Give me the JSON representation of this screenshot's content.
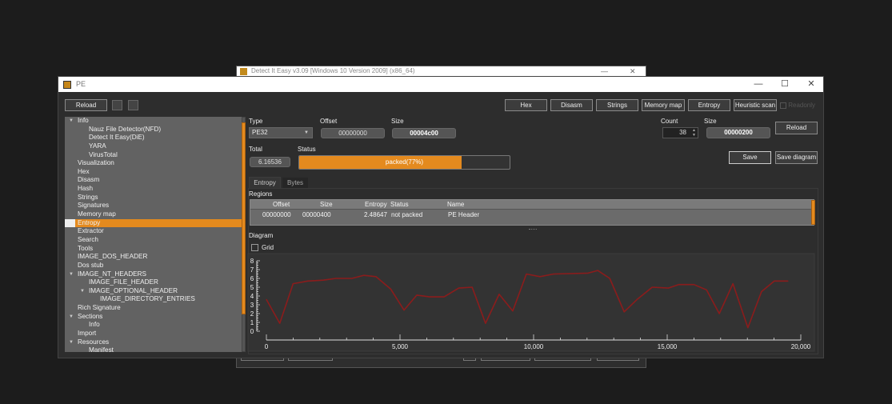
{
  "background_window": {
    "title": "Detect It Easy v3.09 [Windows 10 Version 2009] (x86_64)",
    "controls": {
      "minimize": "—",
      "maximize": "☐",
      "close": "✕"
    }
  },
  "window": {
    "title": "PE",
    "controls": {
      "minimize": "—",
      "maximize": "☐",
      "close": "✕"
    }
  },
  "toolbar": {
    "reload_label": "Reload",
    "buttons": [
      "Hex",
      "Disasm",
      "Strings",
      "Memory map",
      "Entropy",
      "Heuristic scan"
    ],
    "disabled_checkbox_label": "Readonly"
  },
  "sidebar": {
    "items": [
      {
        "label": "Info",
        "level": 0,
        "expanded": true
      },
      {
        "label": "Nauz File Detector(NFD)",
        "level": 1
      },
      {
        "label": "Detect It Easy(DiE)",
        "level": 1
      },
      {
        "label": "YARA",
        "level": 1
      },
      {
        "label": "VirusTotal",
        "level": 1
      },
      {
        "label": "Visualization",
        "level": 0
      },
      {
        "label": "Hex",
        "level": 0
      },
      {
        "label": "Disasm",
        "level": 0
      },
      {
        "label": "Hash",
        "level": 0
      },
      {
        "label": "Strings",
        "level": 0
      },
      {
        "label": "Signatures",
        "level": 0
      },
      {
        "label": "Memory map",
        "level": 0
      },
      {
        "label": "Entropy",
        "level": 0,
        "selected": true
      },
      {
        "label": "Extractor",
        "level": 0
      },
      {
        "label": "Search",
        "level": 0
      },
      {
        "label": "Tools",
        "level": 0
      },
      {
        "label": "IMAGE_DOS_HEADER",
        "level": 0
      },
      {
        "label": "Dos stub",
        "level": 0
      },
      {
        "label": "IMAGE_NT_HEADERS",
        "level": 0,
        "expanded": true
      },
      {
        "label": "IMAGE_FILE_HEADER",
        "level": 1
      },
      {
        "label": "IMAGE_OPTIONAL_HEADER",
        "level": 1,
        "expanded": true
      },
      {
        "label": "IMAGE_DIRECTORY_ENTRIES",
        "level": 2
      },
      {
        "label": "Rich Signature",
        "level": 0
      },
      {
        "label": "Sections",
        "level": 0,
        "expanded": true
      },
      {
        "label": "Info",
        "level": 1
      },
      {
        "label": "Import",
        "level": 0
      },
      {
        "label": "Resources",
        "level": 0,
        "expanded": true
      },
      {
        "label": "Manifest",
        "level": 1
      }
    ]
  },
  "entropy": {
    "type_label": "Type",
    "type_value": "PE32",
    "offset_label": "Offset",
    "offset_value": "00000000",
    "size_label": "Size",
    "size_value": "00004c00",
    "total_label": "Total",
    "total_value": "6.16536",
    "status_label": "Status",
    "status_text": "packed(77%)",
    "status_percent": 77,
    "count_label": "Count",
    "count_value": "38",
    "block_size_label": "Size",
    "block_size_value": "00000200",
    "reload_label": "Reload",
    "save_label": "Save",
    "save_diagram_label": "Save diagram",
    "tabs": [
      "Entropy",
      "Bytes"
    ],
    "active_tab": "Entropy",
    "regions_label": "Regions",
    "regions": {
      "columns": [
        "Offset",
        "Size",
        "Entropy",
        "Status",
        "Name"
      ],
      "rows": [
        {
          "offset": "00000000",
          "size": "00000400",
          "entropy": "2.48647",
          "status": "not packed",
          "name": "PE Header"
        }
      ]
    },
    "diagram_label": "Diagram",
    "grid_label": "Grid",
    "grid_checked": false
  },
  "chart_data": {
    "type": "line",
    "title": "",
    "xlabel": "",
    "ylabel": "",
    "xlim": [
      0,
      20000
    ],
    "ylim": [
      0,
      8
    ],
    "x_ticks": [
      "0",
      "5,000",
      "10,000",
      "15,000",
      "20,000"
    ],
    "x_tick_values": [
      0,
      5000,
      10000,
      15000,
      20000
    ],
    "y_ticks": [
      "0",
      "1",
      "2",
      "3",
      "4",
      "5",
      "6",
      "7",
      "8"
    ],
    "grid": false,
    "line_color": "#8b1c1c",
    "series": [
      {
        "name": "entropy",
        "x": [
          0,
          500,
          1000,
          1550,
          2130,
          2600,
          3200,
          3650,
          4100,
          4650,
          5150,
          5630,
          6110,
          6650,
          7200,
          7700,
          8200,
          8710,
          9220,
          9730,
          10240,
          10750,
          12040,
          12400,
          12850,
          13390,
          13870,
          14440,
          15040,
          15430,
          16000,
          16470,
          16950,
          17460,
          18020,
          18530,
          19010,
          19520
        ],
        "y": [
          3.6,
          0.9,
          5.4,
          5.7,
          5.8,
          6.0,
          6.0,
          6.35,
          6.2,
          4.8,
          2.4,
          4.1,
          3.9,
          3.9,
          4.9,
          5.0,
          0.9,
          4.2,
          2.3,
          6.5,
          6.2,
          6.5,
          6.6,
          6.9,
          6.0,
          2.2,
          3.6,
          5.0,
          4.9,
          5.3,
          5.3,
          4.7,
          2.0,
          5.4,
          0.4,
          4.5,
          5.7,
          5.7
        ]
      }
    ]
  }
}
